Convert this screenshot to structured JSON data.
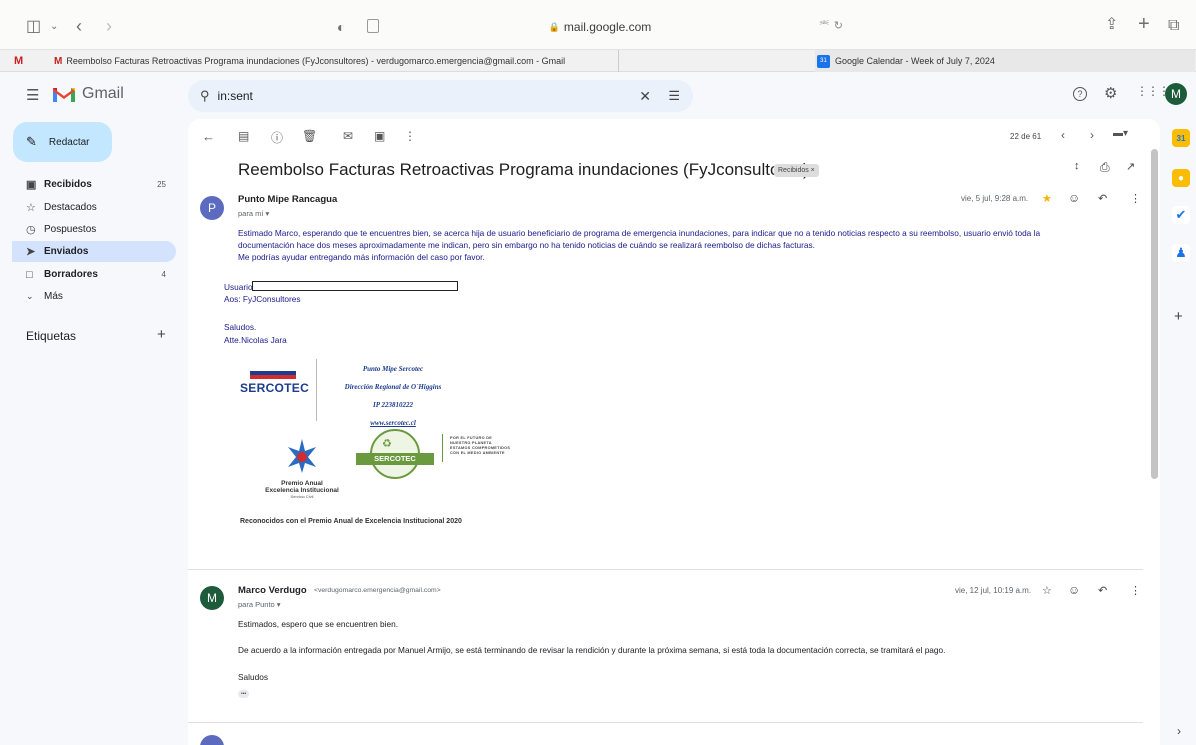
{
  "browser": {
    "url": "mail.google.com",
    "tabs": [
      {
        "favicon": "M",
        "title": "Reembolso Facturas Retroactivas Programa inundaciones (FyJconsultores) - verdugomarco.emergencia@gmail.com - Gmail"
      },
      {
        "favicon": "31",
        "title": "Google Calendar - Week of July 7, 2024"
      }
    ]
  },
  "gmail": {
    "brand": "Gmail",
    "search_value": "in:sent",
    "compose_label": "Redactar",
    "nav": [
      {
        "label": "Recibidos",
        "count": "25",
        "icon": "inbox-icon"
      },
      {
        "label": "Destacados",
        "count": "",
        "icon": "star-icon"
      },
      {
        "label": "Pospuestos",
        "count": "",
        "icon": "clock-icon"
      },
      {
        "label": "Enviados",
        "count": "",
        "icon": "send-icon"
      },
      {
        "label": "Borradores",
        "count": "4",
        "icon": "draft-icon"
      },
      {
        "label": "Más",
        "count": "",
        "icon": "chevron-down-icon"
      }
    ],
    "labels_heading": "Etiquetas",
    "avatar_letter": "M",
    "pager": "22 de 61"
  },
  "thread": {
    "subject": "Reembolso Facturas Retroactivas Programa inundaciones (FyJconsultores)",
    "label_chip": "Recibidos ×",
    "messages": [
      {
        "avatar": "P",
        "sender": "Punto Mipe Rancagua",
        "to": "para mí ▾",
        "date": "vie, 5 jul, 9:28 a.m.",
        "body": [
          "Estimado Marco, esperando que te encuentres bien, se acerca hija de usuario beneficiario de programa de emergencia inundaciones, para indicar que no a tenido noticias respecto a su reembolso, usuario envió toda la",
          "documentación hace dos meses aproximadamente me indican, pero sin embargo no ha tenido noticias de cuándo se realizará reembolso de dichas facturas.",
          "Me podrías ayudar entregando más información del caso por favor."
        ],
        "usuario_label": "Usuario",
        "aos_line": "Aos: FyJConsultores",
        "closing": "Saludos.",
        "signature": "Atte.Nicolas Jara",
        "sig_logo": "SERCOTEC",
        "sig_lines": [
          "Punto Mipe Sercotec",
          "Dirección Regional de O´Higgins",
          "IP 223810222",
          "www.sercotec.cl"
        ],
        "award_text": [
          "Premio Anual",
          "Excelencia Institucional",
          "Servicio Civil"
        ],
        "badge_text": "SERCOTEC",
        "planet_text": [
          "POR EL FUTURO DE",
          "NUESTRO PLANETA",
          "ESTAMOS COMPROMETIDOS",
          "CON EL MEDIO AMBIENTE"
        ],
        "recognition": "Reconocidos con el Premio Anual de Excelencia Institucional 2020"
      },
      {
        "avatar": "M",
        "sender": "Marco Verdugo",
        "sender_email": "<verdugomarco.emergencia@gmail.com>",
        "to": "para Punto ▾",
        "date": "vie, 12 jul, 10:19 a.m.",
        "line1": "Estimados, espero que se encuentren bien.",
        "line2": "De acuerdo a la información entregada por Manuel Armijo, se está terminando de revisar la rendición y durante la próxima semana, si está toda la documentación correcta, se tramitará el pago.",
        "line3": "Saludos",
        "ellipsis": "•••"
      }
    ]
  },
  "colors": {
    "accent_blue": "#0b57d0",
    "compose_bg": "#c2e7ff",
    "selected_nav": "#d3e3fd",
    "body_blue": "#1a1a8a",
    "avatar_p": "#5c6bc0",
    "avatar_m": "#1e5b3a"
  }
}
